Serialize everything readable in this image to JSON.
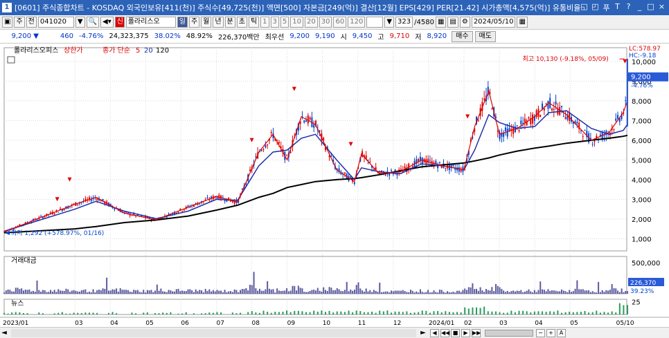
{
  "titlebar": {
    "window_number": "1",
    "title": "[0601] 주식종합차트 - KOSDAQ 외국인보유[411(천)] 주식수[49,725(천)] 액면[500] 자본금[249(억)] 결산[12월] EPS[429] PER[21.42] 시가총액[4,575(억)] 유통비율[71.8]",
    "buttons": [
      "◱",
      "◰",
      "푸",
      "T",
      "?",
      "_",
      "□",
      "×"
    ]
  },
  "toolbar": {
    "type_label": "주",
    "market_label": "전",
    "code": "041020",
    "flag": "신",
    "name": "폴라리스오",
    "periods": [
      "일",
      "주",
      "월",
      "년",
      "분",
      "초",
      "틱"
    ],
    "active_period": "일",
    "intervals": [
      "1",
      "3",
      "5",
      "10",
      "20",
      "30",
      "60",
      "120"
    ],
    "count": "323",
    "total": "/4580",
    "date": "2024/05/10"
  },
  "quote": {
    "price": "9,200 ▼",
    "change": "460",
    "change_pct": "-4.76%",
    "volume": "24,323,375",
    "ratio1": "38.02%",
    "ratio2": "48.92%",
    "amount": "226,370백만",
    "best_label": "최우선",
    "ask": "9,200",
    "bid": "9,190",
    "open_label": "시",
    "open": "9,450",
    "high_label": "고",
    "high": "9,710",
    "low_label": "저",
    "low": "8,920",
    "buy_button": "매수",
    "sell_button": "매도"
  },
  "colors": {
    "up": "#e00000",
    "down": "#0044cc",
    "ma5": "#e00000",
    "ma20": "#1c2fa8",
    "ma120": "#000000",
    "volume": "#5a5aa0",
    "news": "#2a9a5a",
    "price_marker": "#2a5ad8"
  },
  "chart_data": {
    "type": "candlestick",
    "price_panel": {
      "legend": [
        "폴라리스오피스",
        "상한가",
        "종가 단순",
        "5",
        "20",
        "120"
      ],
      "y_ticks": [
        1000,
        2000,
        3000,
        4000,
        5000,
        6000,
        7000,
        8000,
        9000,
        10000
      ],
      "y_tick_labels": [
        "1,000",
        "2,000",
        "3,000",
        "4,000",
        "5,000",
        "6,000",
        "7,000",
        "8,000",
        "9,000",
        "10,000"
      ],
      "ylim": [
        380,
        10700
      ],
      "last_price": "9,200",
      "last_change": "-4.76%",
      "lc_label": "LC:578.97",
      "hc_label": "HC:-9.18",
      "max_annotation": "최고 10,130 (-9.18%, 05/09)",
      "min_annotation": "최저 1,292 (+578.97%, 01/16)",
      "ma_levels": [
        {
          "x": 0.0,
          "ma5": 1350,
          "ma20": 1380,
          "ma120": 1300
        },
        {
          "x": 2.0,
          "ma5": 2750,
          "ma20": 2500,
          "ma120": 1500
        },
        {
          "x": 2.6,
          "ma5": 3100,
          "ma20": 2900,
          "ma120": 1620
        },
        {
          "x": 3.4,
          "ma5": 2300,
          "ma20": 2400,
          "ma120": 1820
        },
        {
          "x": 4.3,
          "ma5": 1960,
          "ma20": 2020,
          "ma120": 1950
        },
        {
          "x": 5.2,
          "ma5": 2600,
          "ma20": 2400,
          "ma120": 2150
        },
        {
          "x": 6.0,
          "ma5": 3150,
          "ma20": 3000,
          "ma120": 2450
        },
        {
          "x": 6.6,
          "ma5": 2850,
          "ma20": 2950,
          "ma120": 2700
        },
        {
          "x": 7.2,
          "ma5": 5400,
          "ma20": 4700,
          "ma120": 3100
        },
        {
          "x": 7.6,
          "ma5": 6300,
          "ma20": 5400,
          "ma120": 3300
        },
        {
          "x": 8.0,
          "ma5": 5000,
          "ma20": 5500,
          "ma120": 3600
        },
        {
          "x": 8.4,
          "ma5": 7200,
          "ma20": 6100,
          "ma120": 3750
        },
        {
          "x": 8.8,
          "ma5": 6800,
          "ma20": 6300,
          "ma120": 3900
        },
        {
          "x": 9.4,
          "ma5": 4500,
          "ma20": 5000,
          "ma120": 4000
        },
        {
          "x": 9.9,
          "ma5": 3900,
          "ma20": 4000,
          "ma120": 4050
        },
        {
          "x": 10.1,
          "ma5": 5300,
          "ma20": 4600,
          "ma120": 4100
        },
        {
          "x": 10.6,
          "ma5": 4300,
          "ma20": 4400,
          "ma120": 4250
        },
        {
          "x": 11.2,
          "ma5": 4400,
          "ma20": 4300,
          "ma120": 4450
        },
        {
          "x": 11.8,
          "ma5": 5000,
          "ma20": 4800,
          "ma120": 4650
        },
        {
          "x": 12.4,
          "ma5": 4700,
          "ma20": 4700,
          "ma120": 4750
        },
        {
          "x": 13.0,
          "ma5": 4500,
          "ma20": 4500,
          "ma120": 4850
        },
        {
          "x": 13.3,
          "ma5": 6700,
          "ma20": 5500,
          "ma120": 4950
        },
        {
          "x": 13.7,
          "ma5": 8500,
          "ma20": 7300,
          "ma120": 5100
        },
        {
          "x": 14.0,
          "ma5": 6300,
          "ma20": 6900,
          "ma120": 5250
        },
        {
          "x": 14.5,
          "ma5": 6600,
          "ma20": 6600,
          "ma120": 5450
        },
        {
          "x": 15.0,
          "ma5": 7200,
          "ma20": 6700,
          "ma120": 5600
        },
        {
          "x": 15.4,
          "ma5": 7900,
          "ma20": 7400,
          "ma120": 5700
        },
        {
          "x": 15.9,
          "ma5": 7300,
          "ma20": 7500,
          "ma120": 5850
        },
        {
          "x": 16.6,
          "ma5": 6000,
          "ma20": 6600,
          "ma120": 6000
        },
        {
          "x": 17.1,
          "ma5": 6400,
          "ma20": 6300,
          "ma120": 6100
        },
        {
          "x": 17.5,
          "ma5": 7400,
          "ma20": 6500,
          "ma120": 6200
        },
        {
          "x": 17.62,
          "ma5": 8000,
          "ma20": 6800,
          "ma120": 6250
        }
      ]
    },
    "volume_panel": {
      "title": "거래대금",
      "y_tick_labels": [
        "500,000"
      ],
      "ylim": [
        0,
        600000
      ],
      "last_value": "226,370",
      "last_ratio": "39.23%"
    },
    "news_panel": {
      "title": "뉴스",
      "y_tick_labels": [
        "25"
      ],
      "ylim": [
        0,
        30
      ]
    },
    "x_axis": {
      "month_labels": [
        "2023/01",
        "03",
        "04",
        "05",
        "06",
        "07",
        "08",
        "09",
        "10",
        "11",
        "12",
        "2024/01",
        "02",
        "03",
        "04",
        "05",
        "05/10"
      ],
      "month_positions": [
        0,
        2,
        3,
        4,
        5,
        6,
        7,
        8,
        9,
        10,
        11,
        12,
        13,
        14,
        15,
        16,
        17.3
      ]
    }
  },
  "scrollbar": {
    "left_arrow": "◄",
    "right_arrow": "►",
    "controls": [
      "◀",
      "◀◀",
      "■",
      "▶",
      "▶▶"
    ],
    "zoom": [
      "−",
      "+",
      "A"
    ]
  }
}
